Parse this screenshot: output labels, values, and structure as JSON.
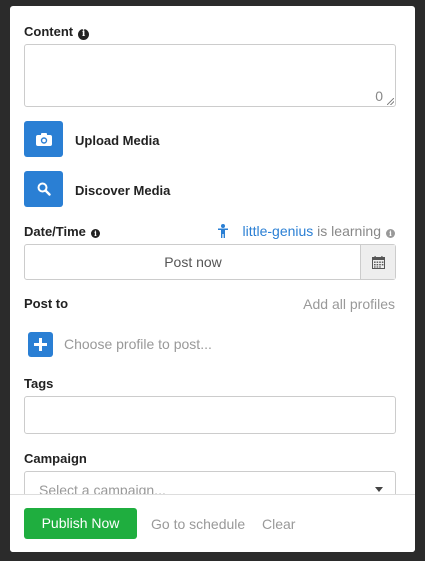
{
  "content": {
    "label": "Content",
    "info_icon": "info-icon",
    "char_count": "0"
  },
  "media": {
    "upload_label": "Upload Media",
    "upload_icon": "camera-icon",
    "discover_label": "Discover Media",
    "discover_icon": "search-icon"
  },
  "datetime": {
    "label": "Date/Time",
    "learning_link": "little-genius",
    "learning_text": " is learning",
    "value": "Post now",
    "calendar_icon": "calendar-icon"
  },
  "post_to": {
    "label": "Post to",
    "add_all": "Add all profiles",
    "choose_placeholder": "Choose profile to post..."
  },
  "tags": {
    "label": "Tags",
    "value": ""
  },
  "campaign": {
    "label": "Campaign",
    "placeholder": "Select a campaign..."
  },
  "footer": {
    "publish_label": "Publish Now",
    "schedule_label": "Go to schedule",
    "clear_label": "Clear"
  },
  "colors": {
    "accent_blue": "#2a7fd4",
    "publish_green": "#1fae3f",
    "background": "#2b2b2b"
  }
}
